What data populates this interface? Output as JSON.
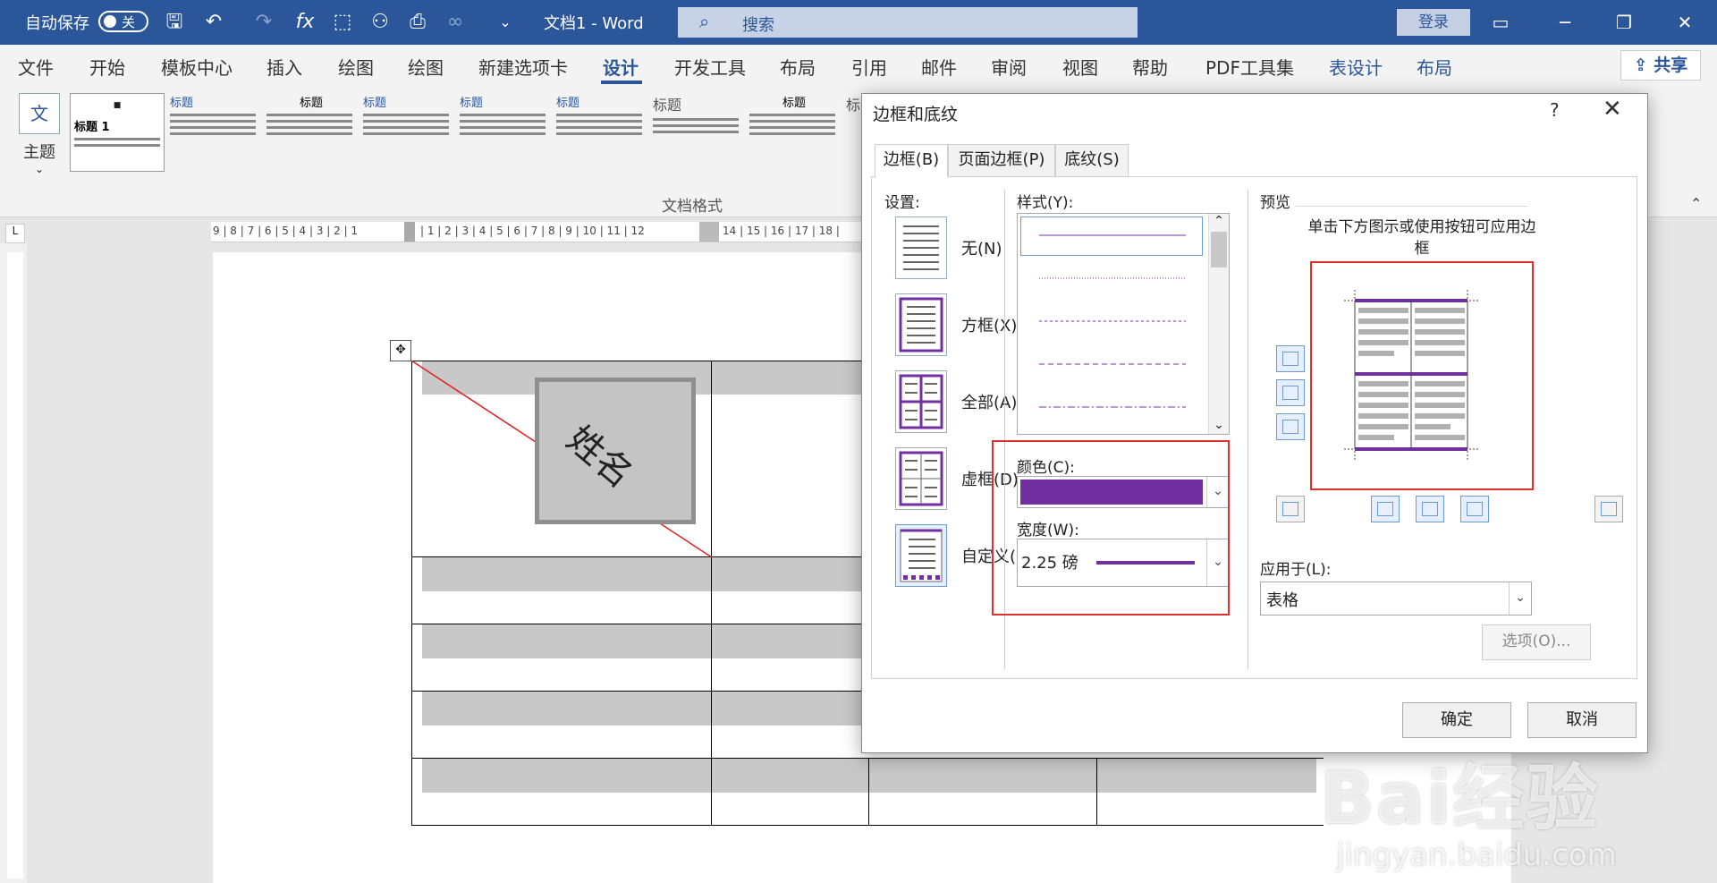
{
  "titlebar": {
    "autosave_label": "自动保存",
    "autosave_state": "关",
    "doc_title": "文档1  -  Word",
    "search_placeholder": "搜索",
    "login": "登录"
  },
  "menu": {
    "items": [
      "文件",
      "开始",
      "模板中心",
      "插入",
      "绘图",
      "绘图",
      "新建选项卡",
      "设计",
      "开发工具",
      "布局",
      "引用",
      "邮件",
      "审阅",
      "视图",
      "帮助",
      "PDF工具集",
      "表设计",
      "布局"
    ],
    "active": "设计",
    "share": "共享"
  },
  "ribbon": {
    "theme_label": "主题",
    "theme_icon_text": "文",
    "style_thumbs": [
      {
        "label": "标题 1"
      },
      {
        "label": "标题"
      },
      {
        "label": "标题"
      },
      {
        "label": "标题"
      },
      {
        "label": "标题"
      },
      {
        "label": "标题"
      },
      {
        "label": "标题"
      },
      {
        "label": "标题"
      },
      {
        "label": "标"
      }
    ],
    "gallery_label": "文档格式"
  },
  "ruler": {
    "left_numbers": "9 | 8 | 7 | 6 | 5 | 4 | 3 | 2 | 1",
    "right_numbers": "| 1 | 2 | 3 | 4 | 5 | 6 | 7 | 8 | 9 | 10 | 11 | 12",
    "tail_numbers": "14 | 15 | 16 | 17 | 18 |"
  },
  "document": {
    "cell_text": "姓名"
  },
  "dialog": {
    "title": "边框和底纹",
    "help": "?",
    "tabs": [
      "边框(B)",
      "页面边框(P)",
      "底纹(S)"
    ],
    "setting_label": "设置:",
    "settings": [
      "无(N)",
      "方框(X)",
      "全部(A)",
      "虚框(D)",
      "自定义(U)"
    ],
    "style_label": "样式(Y):",
    "color_label": "颜色(C):",
    "color_value": "#7030a0",
    "width_label": "宽度(W):",
    "width_value": "2.25 磅",
    "preview_label": "预览",
    "preview_hint": "单击下方图示或使用按钮可应用边框",
    "apply_label": "应用于(L):",
    "apply_value": "表格",
    "options_button": "选项(O)...",
    "ok_button": "确定",
    "cancel_button": "取消"
  },
  "watermark": {
    "text": "Bai经验",
    "sub": "jingyan.baidu.com"
  },
  "colors": {
    "accent": "#2b579a",
    "border_purple": "#7030a0",
    "highlight_red": "#e03030"
  }
}
